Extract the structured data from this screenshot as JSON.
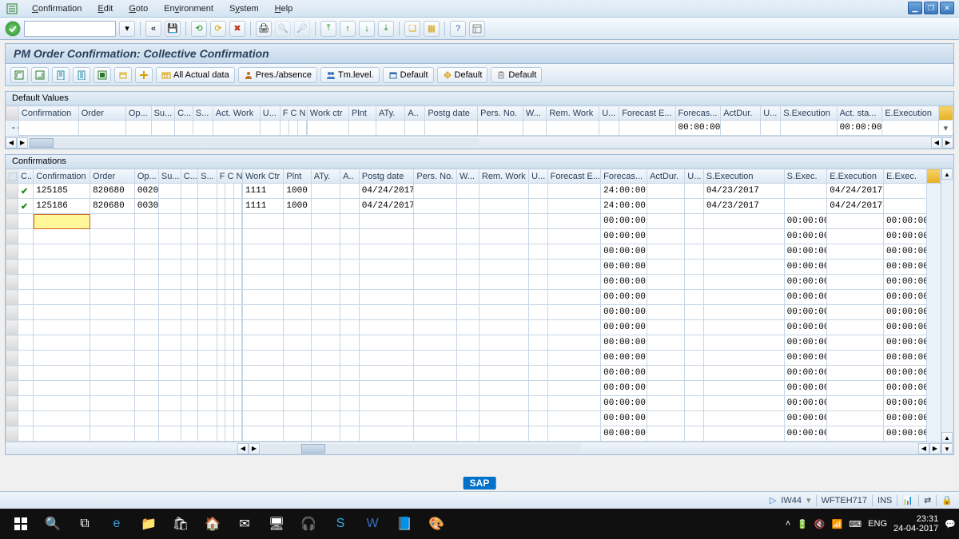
{
  "menu": {
    "items": [
      "Confirmation",
      "Edit",
      "Goto",
      "Environment",
      "System",
      "Help"
    ]
  },
  "title": "PM Order Confirmation: Collective Confirmation",
  "appToolbar": {
    "allActual": "All Actual data",
    "presAbsence": "Pres./absence",
    "tmLevel": "Tm.level.",
    "default1": "Default",
    "default2": "Default",
    "default3": "Default"
  },
  "panels": {
    "defaultValues": "Default Values",
    "confirmations": "Confirmations"
  },
  "arrowLabel": "-->",
  "columns": {
    "default": [
      "",
      "Confirmation",
      "Order",
      "Op...",
      "Su...",
      "C...",
      "S...",
      "Act. Work",
      "U...",
      "F C N",
      "Work ctr",
      "Plnt",
      "ATy.",
      "A..",
      "Postg date",
      "Pers. No.",
      "W...",
      "Rem. Work",
      "U...",
      "Forecast E...",
      "Forecas...",
      "ActDur.",
      "U...",
      "S.Execution",
      "Act. sta...",
      "E.Execution",
      ""
    ],
    "confirm": [
      "",
      "C..",
      "Confirmation",
      "Order",
      "Op...",
      "Su...",
      "C...",
      "S...",
      "F C N",
      "Work Ctr",
      "Plnt",
      "ATy.",
      "A..",
      "Postg date",
      "Pers. No.",
      "W...",
      "Rem. Work",
      "U...",
      "Forecast E...",
      "Forecas...",
      "ActDur.",
      "U...",
      "S.Execution",
      "S.Exec.",
      "E.Execution",
      "E.Exec.",
      ""
    ]
  },
  "defaultRow": {
    "forecast_end": "00:00:00",
    "act_start": "00:00:00"
  },
  "rows": [
    {
      "check": true,
      "conf": "125185",
      "order": "820680",
      "op": "0020",
      "wctr": "1111",
      "plnt": "1000",
      "postg": "04/24/2017",
      "fc": "24:00:00",
      "sexec": "04/23/2017",
      "eexec": "04/24/2017"
    },
    {
      "check": true,
      "conf": "125186",
      "order": "820680",
      "op": "0030",
      "wctr": "1111",
      "plnt": "1000",
      "postg": "04/24/2017",
      "fc": "24:00:00",
      "sexec": "04/23/2017",
      "eexec": "04/24/2017"
    }
  ],
  "zeroTime": "00:00:00",
  "statusBar": {
    "tcode": "IW44",
    "system": "WFTEH717",
    "mode": "INS",
    "triangle": "▷"
  },
  "sapLogo": "SAP",
  "taskbar": {
    "lang": "ENG",
    "time": "23:31",
    "date": "24-04-2017"
  }
}
